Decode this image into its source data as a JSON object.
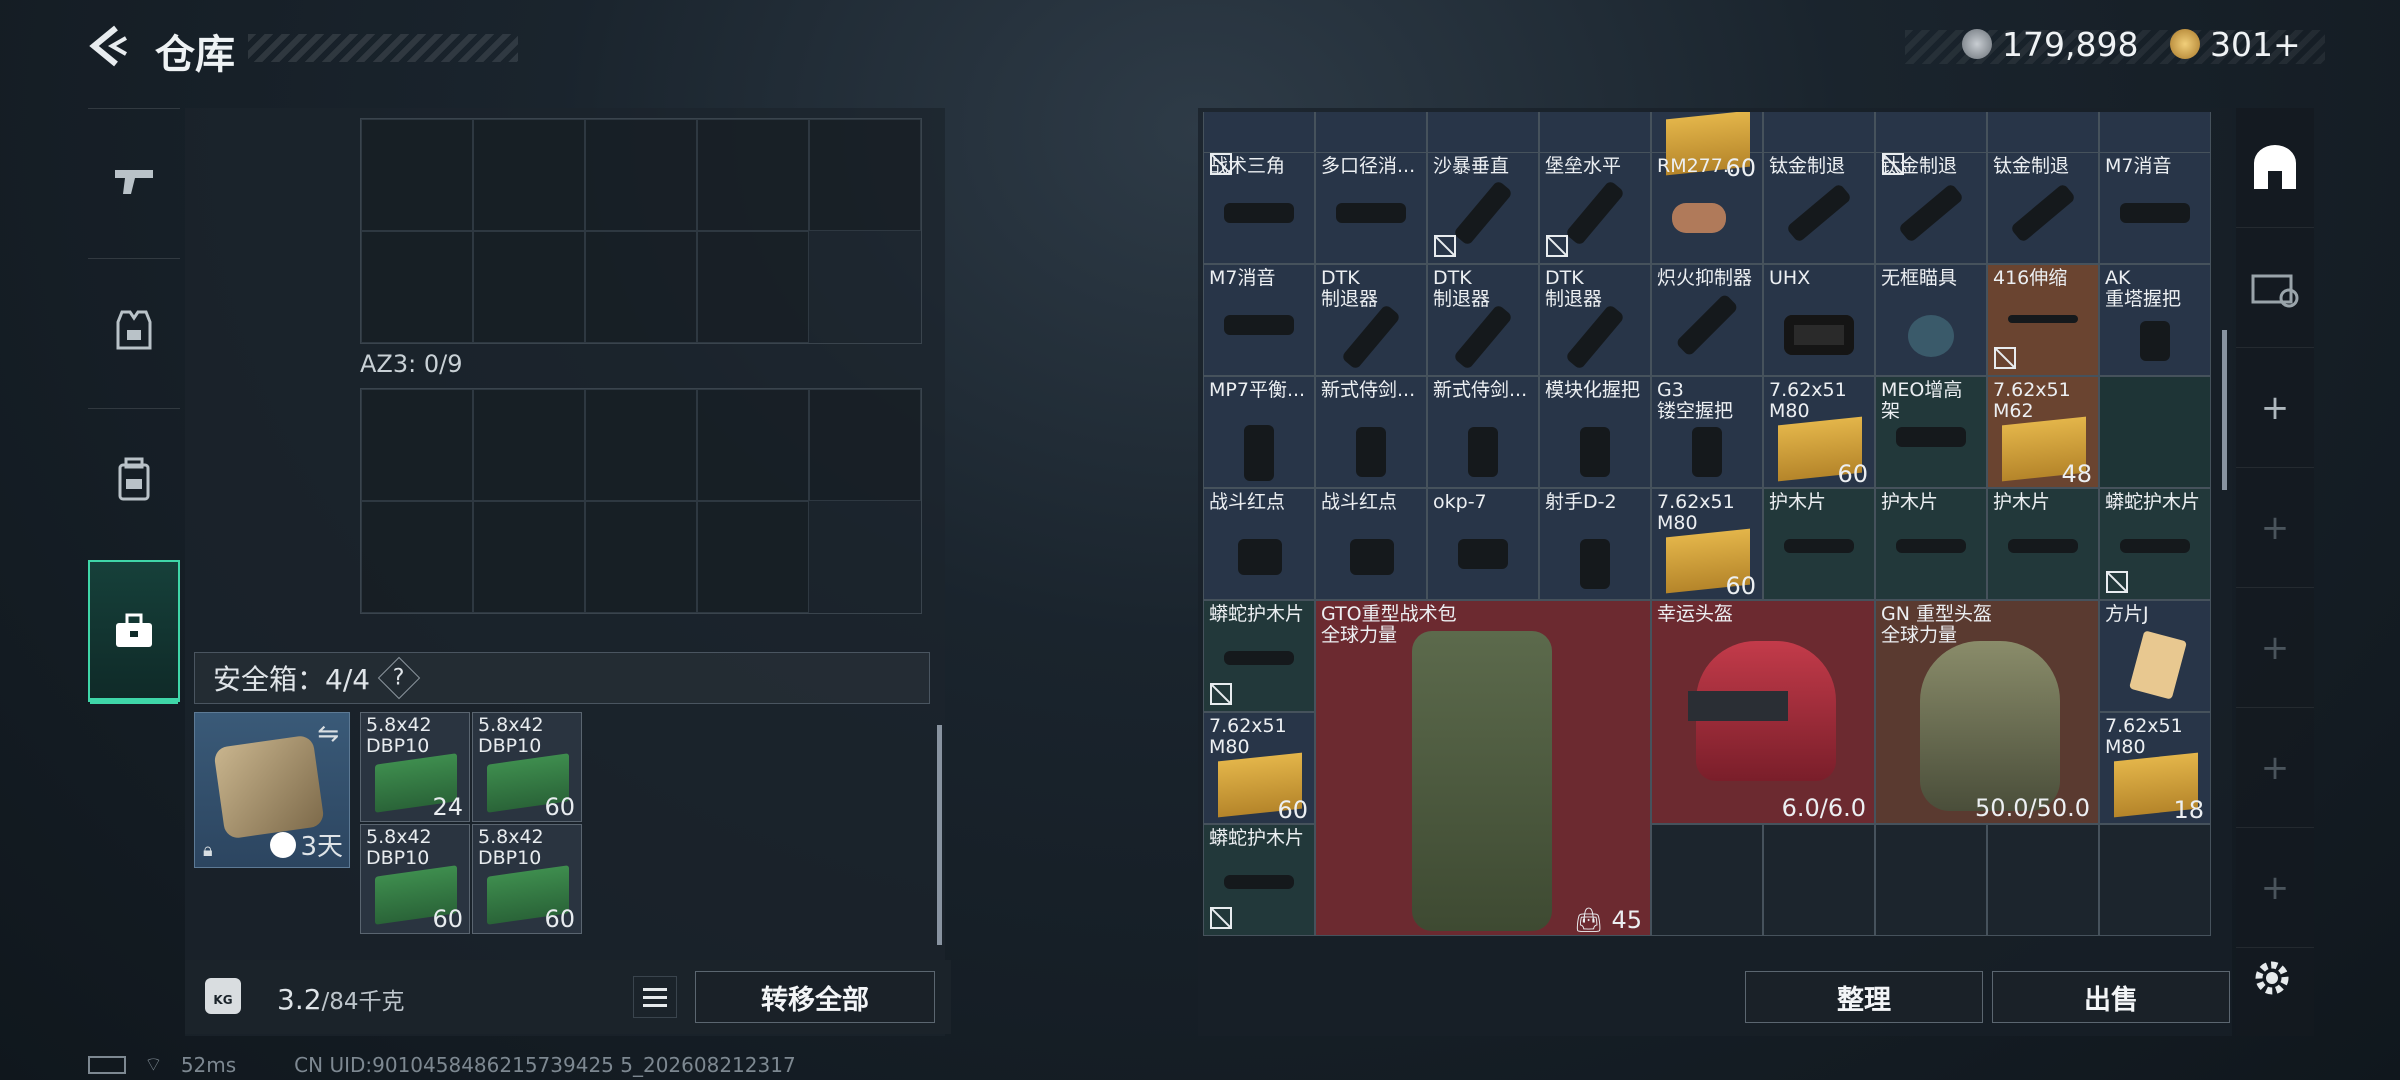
{
  "header": {
    "title": "仓库",
    "currency1": "179,898",
    "currency2": "301+"
  },
  "left_rail": {
    "tabs": [
      "weapon",
      "vest",
      "backpack",
      "safe-box"
    ]
  },
  "left_panel": {
    "container_label": "AZ3: 0/9"
  },
  "safebox": {
    "label": "安全箱：4/4",
    "help": "?",
    "timer": "3天",
    "slots": [
      {
        "name": "5.8x42\nDBP10",
        "count": "24"
      },
      {
        "name": "5.8x42\nDBP10",
        "count": "60"
      },
      {
        "name": "5.8x42\nDBP10",
        "count": "60"
      },
      {
        "name": "5.8x42\nDBP10",
        "count": "60"
      }
    ]
  },
  "bottom": {
    "weight": "3.2",
    "max_weight": "/84千克",
    "transfer_all": "转移全部",
    "tidy": "整理",
    "sell": "出售"
  },
  "status": {
    "ping": "52ms",
    "uid": "CN UID:9010458486215739425 5_202608212317"
  },
  "items": {
    "row0": [
      {
        "count": "60"
      }
    ],
    "row1": [
      {
        "name": "战术三角"
      },
      {
        "name": "多口径消..."
      },
      {
        "name": "沙暴垂直"
      },
      {
        "name": "堡垒水平"
      },
      {
        "name": "RM277..."
      },
      {
        "name": "钛金制退"
      },
      {
        "name": "钛金制退"
      },
      {
        "name": "钛金制退"
      },
      {
        "name": "M7消音"
      }
    ],
    "row2": [
      {
        "name": "M7消音"
      },
      {
        "name": "DTK\n制退器"
      },
      {
        "name": "DTK\n制退器"
      },
      {
        "name": "DTK\n制退器"
      },
      {
        "name": "炽火抑制器"
      },
      {
        "name": "UHX"
      },
      {
        "name": "无框瞄具"
      },
      {
        "name": "416伸缩"
      },
      {
        "name": "AK\n重塔握把"
      }
    ],
    "row3": [
      {
        "name": "MP7平衡..."
      },
      {
        "name": "新式侍剑..."
      },
      {
        "name": "新式侍剑..."
      },
      {
        "name": "模块化握把"
      },
      {
        "name": "G3\n镂空握把"
      },
      {
        "name": "7.62x51\nM80",
        "count": "60"
      },
      {
        "name": "MEO增高架"
      },
      {
        "name": "7.62x51\nM62",
        "count": "48"
      }
    ],
    "row4": [
      {
        "name": "战斗红点"
      },
      {
        "name": "战斗红点"
      },
      {
        "name": "okp-7"
      },
      {
        "name": "射手D-2"
      },
      {
        "name": "7.62x51\nM80",
        "count": "60"
      },
      {
        "name": "护木片"
      },
      {
        "name": "护木片"
      },
      {
        "name": "护木片"
      },
      {
        "name": "蟒蛇护木片"
      }
    ],
    "row5": [
      {
        "name": "蟒蛇护木片"
      },
      {
        "name": "方片J"
      }
    ],
    "row6": [
      {
        "name": "7.62x51\nM80",
        "count": "60"
      },
      {
        "name": "7.62x51\nM80",
        "count": "18"
      }
    ],
    "row7": [
      {
        "name": "蟒蛇护木片"
      }
    ],
    "bag": {
      "name": "GTO重型战术包\n全球力量",
      "count": "45"
    },
    "helmet1": {
      "name": "幸运头盔",
      "durability": "6.0/6.0"
    },
    "helmet2": {
      "name": "GN 重型头盔\n全球力量",
      "durability": "50.0/50.0"
    }
  },
  "colors": {
    "accent": "#3fd6a8",
    "red_item": "#6c2a30",
    "teal_item": "#22383a",
    "blue_item": "#283548"
  }
}
